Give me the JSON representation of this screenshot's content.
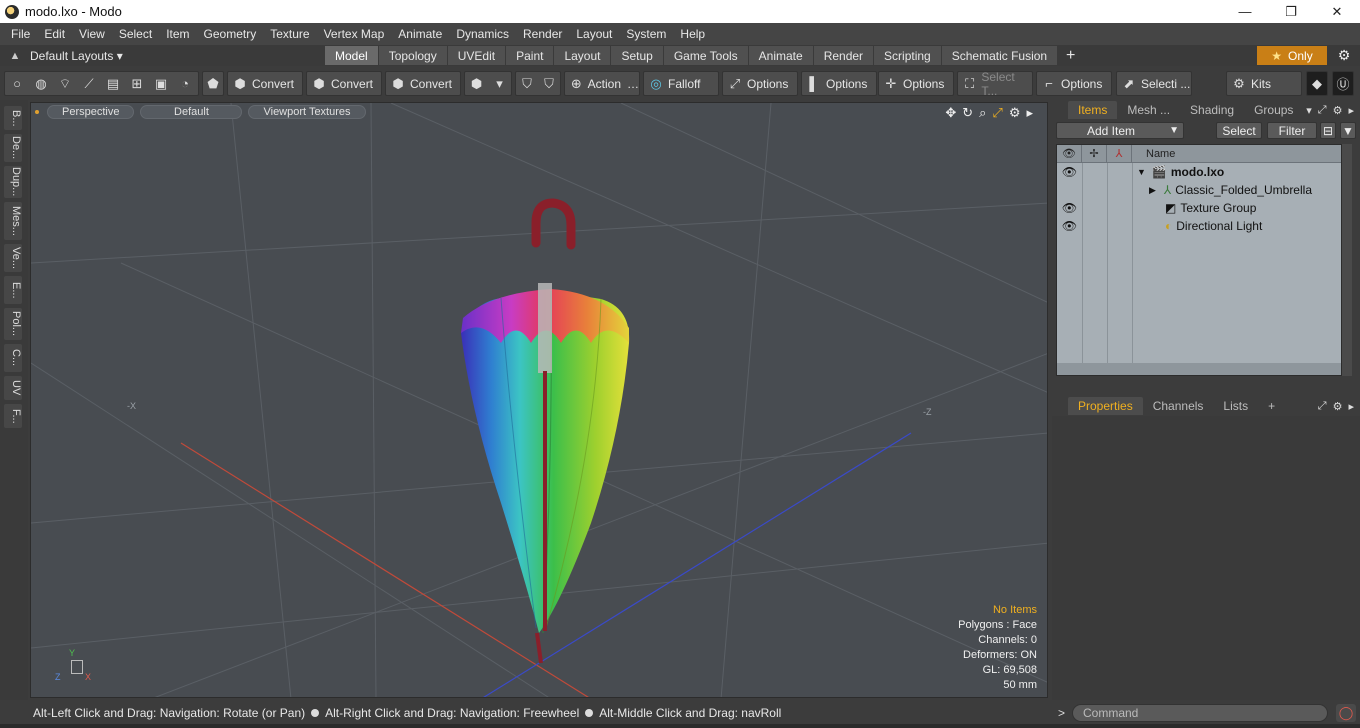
{
  "window": {
    "title": "modo.lxo - Modo",
    "minimize": "—",
    "maximize": "❐",
    "close": "✕"
  },
  "menubar": [
    "File",
    "Edit",
    "View",
    "Select",
    "Item",
    "Geometry",
    "Texture",
    "Vertex Map",
    "Animate",
    "Dynamics",
    "Render",
    "Layout",
    "System",
    "Help"
  ],
  "layoutbar": {
    "layout_select": "Default Layouts ▾",
    "tabs": [
      "Model",
      "Topology",
      "UVEdit",
      "Paint",
      "Layout",
      "Setup",
      "Game Tools",
      "Animate",
      "Render",
      "Scripting",
      "Schematic Fusion"
    ],
    "active_tab": "Model",
    "add_tab": "+",
    "only_label": "Only",
    "only_star": "★",
    "gear": "⚙"
  },
  "toolbar": {
    "convert_1": "Convert",
    "convert_2": "Convert",
    "convert_3": "Convert",
    "action": "Action",
    "action_more": "…",
    "falloff": "Falloff",
    "options_1": "Options",
    "options_2": "Options",
    "options_3": "Options",
    "select_t": "Select T...",
    "options_4": "Options",
    "selecti": "Selecti ...",
    "kits": "Kits"
  },
  "left_tabs": [
    "B...",
    "De...",
    "Dup...",
    "Mes...",
    "Ve...",
    "E...",
    "Pol...",
    "C...",
    "UV",
    "F..."
  ],
  "viewport": {
    "perspective": "Perspective",
    "default": "Default",
    "viewport_textures": "Viewport Textures",
    "axis_minus_x": "-X",
    "axis_minus_z": "-Z",
    "gizmo_y": "Y",
    "gizmo_z": "Z",
    "gizmo_x": "X",
    "info": {
      "no_items": "No Items",
      "polygons": "Polygons : Face",
      "channels": "Channels: 0",
      "deformers": "Deformers: ON",
      "gl": "GL: 69,508",
      "focal": "50 mm"
    }
  },
  "items_panel": {
    "tabs": [
      "Items",
      "Mesh ...",
      "Shading",
      "Groups"
    ],
    "active_tab": "Items",
    "add_item": "Add Item",
    "select": "Select",
    "filter": "Filter",
    "name_header": "Name",
    "tree": [
      {
        "label": "modo.lxo",
        "bold": true
      },
      {
        "label": "Classic_Folded_Umbrella"
      },
      {
        "label": "Texture Group"
      },
      {
        "label": "Directional Light"
      }
    ]
  },
  "properties_panel": {
    "tabs": [
      "Properties",
      "Channels",
      "Lists"
    ],
    "active_tab": "Properties",
    "add": "+"
  },
  "command": {
    "placeholder": "Command"
  },
  "status": {
    "hint1": "Alt-Left Click and Drag: Navigation: Rotate (or Pan)",
    "hint2": "Alt-Right Click and Drag: Navigation: Freewheel",
    "hint3": "Alt-Middle Click and Drag: navRoll"
  },
  "colors": {
    "accent_orange": "#f0b020",
    "only_button": "#c97f16",
    "viewport_bg": "#484c51",
    "tree_bg": "#a7afb5"
  }
}
